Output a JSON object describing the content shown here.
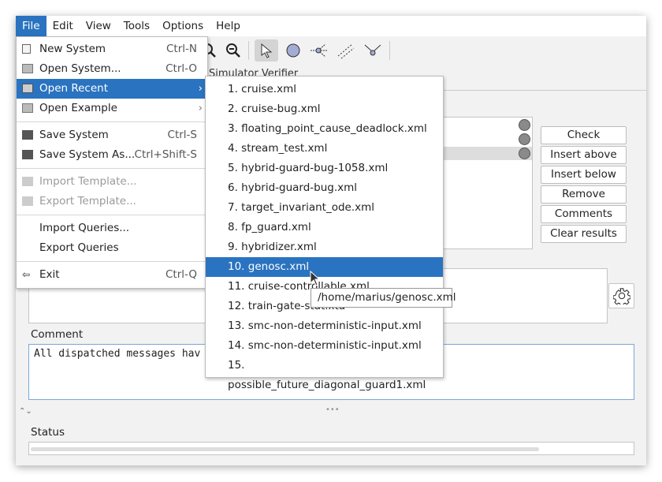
{
  "menubar": {
    "items": [
      "File",
      "Edit",
      "View",
      "Tools",
      "Options",
      "Help"
    ]
  },
  "tabs": {
    "partial_text": "Simulator   Verifier"
  },
  "file_menu": {
    "items": [
      {
        "label": "New System",
        "shortcut": "Ctrl-N",
        "icon": "new-file-icon"
      },
      {
        "label": "Open System...",
        "shortcut": "Ctrl-O",
        "icon": "folder-icon"
      },
      {
        "label": "Open Recent",
        "arrow": "›",
        "icon": "folder-open-icon"
      },
      {
        "label": "Open Example",
        "arrow": "›",
        "icon": "folder-icon"
      },
      {
        "label": "Save System",
        "shortcut": "Ctrl-S",
        "icon": "save-icon"
      },
      {
        "label": "Save System As...",
        "shortcut": "Ctrl+Shift-S",
        "icon": "save-as-icon"
      },
      {
        "label": "Import Template...",
        "icon": "import-icon"
      },
      {
        "label": "Export Template...",
        "icon": "export-icon"
      },
      {
        "label": "Import Queries..."
      },
      {
        "label": "Export Queries"
      },
      {
        "label": "Exit",
        "shortcut": "Ctrl-Q",
        "icon": "exit-icon"
      }
    ]
  },
  "recent_menu": {
    "items": [
      "1. cruise.xml",
      "2. cruise-bug.xml",
      "3. floating_point_cause_deadlock.xml",
      "4. stream_test.xml",
      "5. hybrid-guard-bug-1058.xml",
      "6. hybrid-guard-bug.xml",
      "7. target_invariant_ode.xml",
      "8. fp_guard.xml",
      "9. hybridizer.xml",
      "10. genosc.xml",
      "11. cruise-controllable.xml",
      "12. train-gate-stat.xta",
      "13. smc-non-deterministic-input.xml",
      "14. smc-non-deterministic-input.xml",
      "15. possible_future_diagonal_guard1.xml"
    ],
    "selected": "10. genosc.xml"
  },
  "tooltip": "/home/marius/genosc.xml",
  "buttons": [
    "Check",
    "Insert above",
    "Insert below",
    "Remove",
    "Comments",
    "Clear results"
  ],
  "comment": {
    "label": "Comment",
    "value": "All dispatched messages hav"
  },
  "status": {
    "label": "Status"
  },
  "colors": {
    "accent": "#2a73c0",
    "window_bg": "#f2f2f2"
  }
}
